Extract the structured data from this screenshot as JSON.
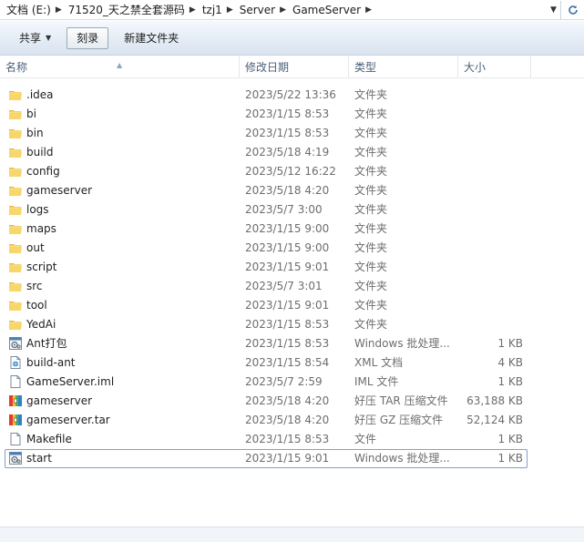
{
  "address": {
    "crumbs": [
      "文档 (E:)",
      "71520_天之禁全套源码",
      "tzj1",
      "Server",
      "GameServer"
    ]
  },
  "toolbar": {
    "share_label": "共享",
    "burn_label": "刻录",
    "new_folder_label": "新建文件夹"
  },
  "columns": {
    "name": "名称",
    "date": "修改日期",
    "type": "类型",
    "size": "大小"
  },
  "files": [
    {
      "name": ".idea",
      "date": "2023/5/22 13:36",
      "type": "文件夹",
      "size": "",
      "icon": "folder-icon"
    },
    {
      "name": "bi",
      "date": "2023/1/15 8:53",
      "type": "文件夹",
      "size": "",
      "icon": "folder-icon"
    },
    {
      "name": "bin",
      "date": "2023/1/15 8:53",
      "type": "文件夹",
      "size": "",
      "icon": "folder-icon"
    },
    {
      "name": "build",
      "date": "2023/5/18 4:19",
      "type": "文件夹",
      "size": "",
      "icon": "folder-icon"
    },
    {
      "name": "config",
      "date": "2023/5/12 16:22",
      "type": "文件夹",
      "size": "",
      "icon": "folder-icon"
    },
    {
      "name": "gameserver",
      "date": "2023/5/18 4:20",
      "type": "文件夹",
      "size": "",
      "icon": "folder-icon"
    },
    {
      "name": "logs",
      "date": "2023/5/7 3:00",
      "type": "文件夹",
      "size": "",
      "icon": "folder-icon"
    },
    {
      "name": "maps",
      "date": "2023/1/15 9:00",
      "type": "文件夹",
      "size": "",
      "icon": "folder-icon"
    },
    {
      "name": "out",
      "date": "2023/1/15 9:00",
      "type": "文件夹",
      "size": "",
      "icon": "folder-icon"
    },
    {
      "name": "script",
      "date": "2023/1/15 9:01",
      "type": "文件夹",
      "size": "",
      "icon": "folder-icon"
    },
    {
      "name": "src",
      "date": "2023/5/7 3:01",
      "type": "文件夹",
      "size": "",
      "icon": "folder-icon"
    },
    {
      "name": "tool",
      "date": "2023/1/15 9:01",
      "type": "文件夹",
      "size": "",
      "icon": "folder-icon"
    },
    {
      "name": "YedAi",
      "date": "2023/1/15 8:53",
      "type": "文件夹",
      "size": "",
      "icon": "folder-icon"
    },
    {
      "name": "Ant打包",
      "date": "2023/1/15 8:53",
      "type": "Windows 批处理...",
      "size": "1 KB",
      "icon": "batch-file-icon"
    },
    {
      "name": "build-ant",
      "date": "2023/1/15 8:54",
      "type": "XML 文档",
      "size": "4 KB",
      "icon": "xml-file-icon"
    },
    {
      "name": "GameServer.iml",
      "date": "2023/5/7 2:59",
      "type": "IML 文件",
      "size": "1 KB",
      "icon": "file-icon"
    },
    {
      "name": "gameserver",
      "date": "2023/5/18 4:20",
      "type": "好压 TAR 压缩文件",
      "size": "63,188 KB",
      "icon": "archive-icon"
    },
    {
      "name": "gameserver.tar",
      "date": "2023/5/18 4:20",
      "type": "好压 GZ 压缩文件",
      "size": "52,124 KB",
      "icon": "archive-icon"
    },
    {
      "name": "Makefile",
      "date": "2023/1/15 8:53",
      "type": "文件",
      "size": "1 KB",
      "icon": "file-icon"
    },
    {
      "name": "start",
      "date": "2023/1/15 9:01",
      "type": "Windows 批处理...",
      "size": "1 KB",
      "icon": "batch-file-icon",
      "focused": true
    }
  ]
}
